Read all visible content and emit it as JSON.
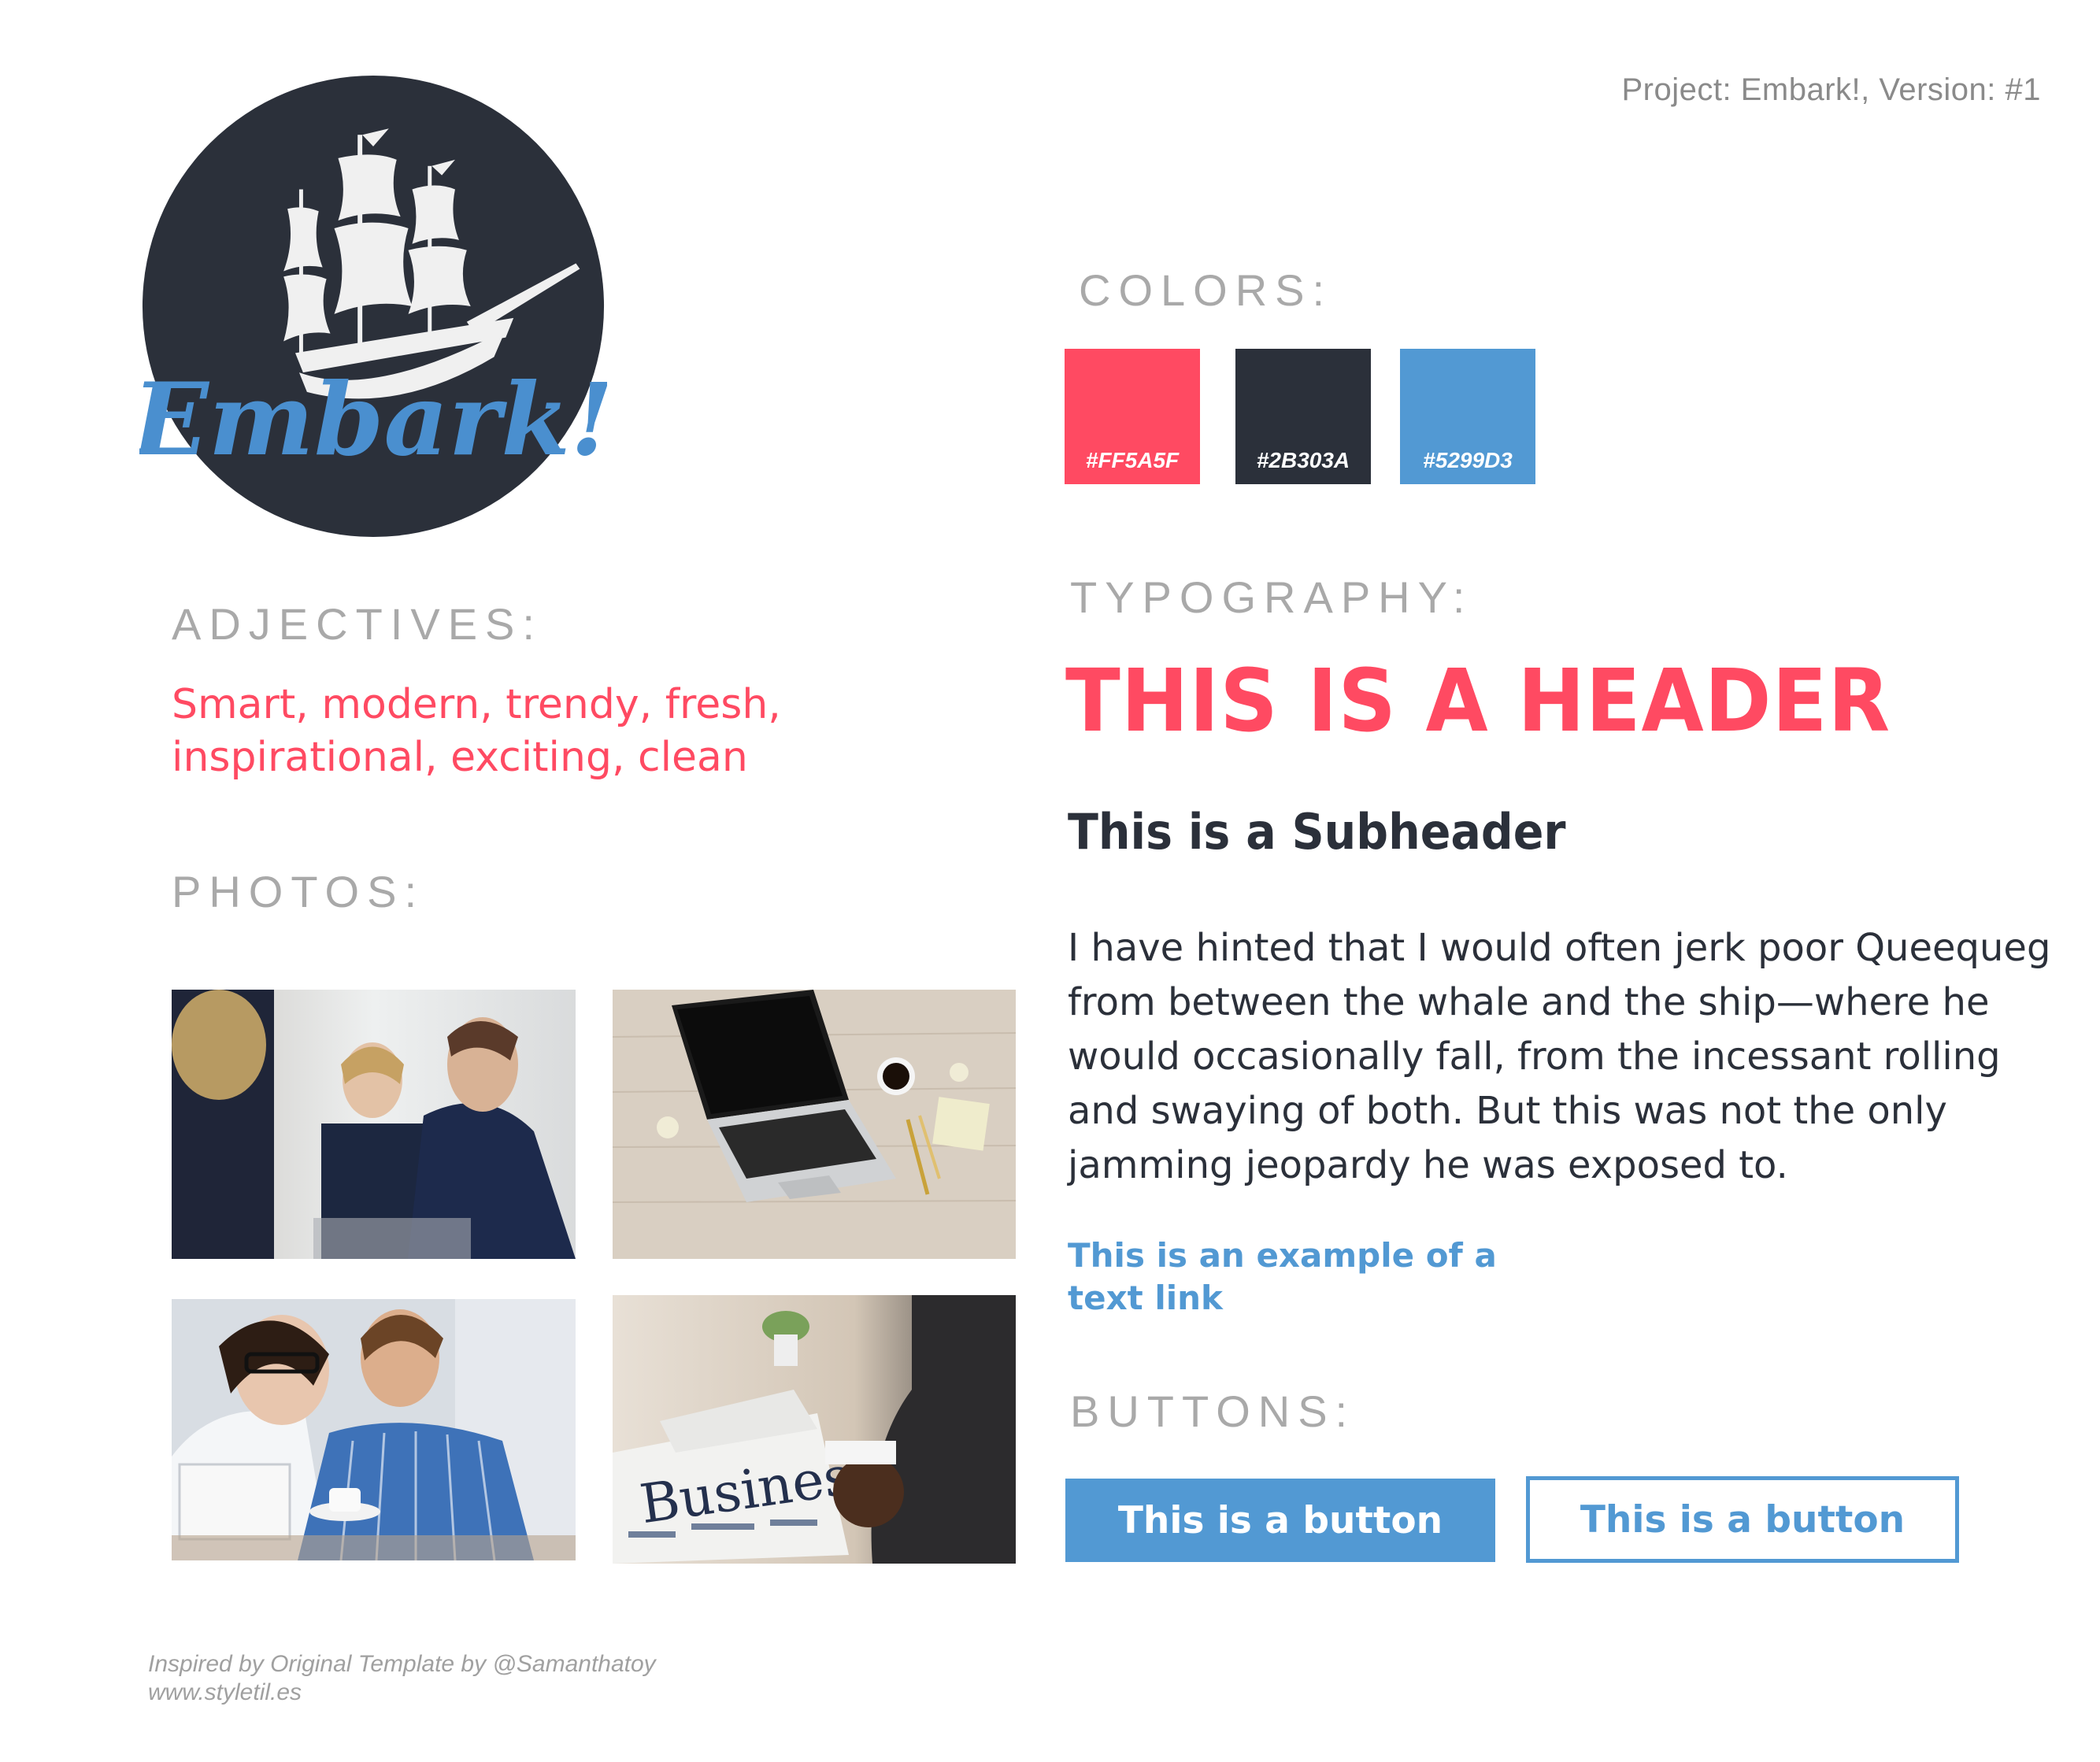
{
  "header": {
    "project_label": "Project: Embark!, Version:  #1"
  },
  "logo": {
    "wordmark": "Embark!"
  },
  "sections": {
    "adjectives": "ADJECTIVES:",
    "photos": "PHOTOS:",
    "colors": "COLORS:",
    "typography": "TYPOGRAPHY:",
    "buttons": "BUTTONS:"
  },
  "adjectives_text": "Smart, modern, trendy, fresh, inspirational, exciting, clean",
  "colors": [
    {
      "hex": "#FF5A5F",
      "value": "#ff4a62"
    },
    {
      "hex": "#2B303A",
      "value": "#2b303a"
    },
    {
      "hex": "#5299D3",
      "value": "#5299d3"
    }
  ],
  "typography": {
    "header": "THIS IS A HEADER",
    "subheader": "This is a Subheader",
    "body": "I have hinted that I would often jerk poor Queequeg from between the whale and the ship—where he would occasionally fall, from the incessant rolling and swaying of both. But this was not the only jamming jeopardy he was exposed to.",
    "link": "This is an example of a text link"
  },
  "buttons": {
    "primary": "This is a button",
    "secondary": "This is a button"
  },
  "photos": [
    {
      "subject": "business-meeting-photo"
    },
    {
      "subject": "laptop-desk-photo"
    },
    {
      "subject": "coworkers-laptop-photo"
    },
    {
      "subject": "business-newspaper-photo"
    }
  ],
  "footer": {
    "line1": "Inspired by Original Template by @Samanthatoy",
    "line2": "www.styletil.es"
  }
}
